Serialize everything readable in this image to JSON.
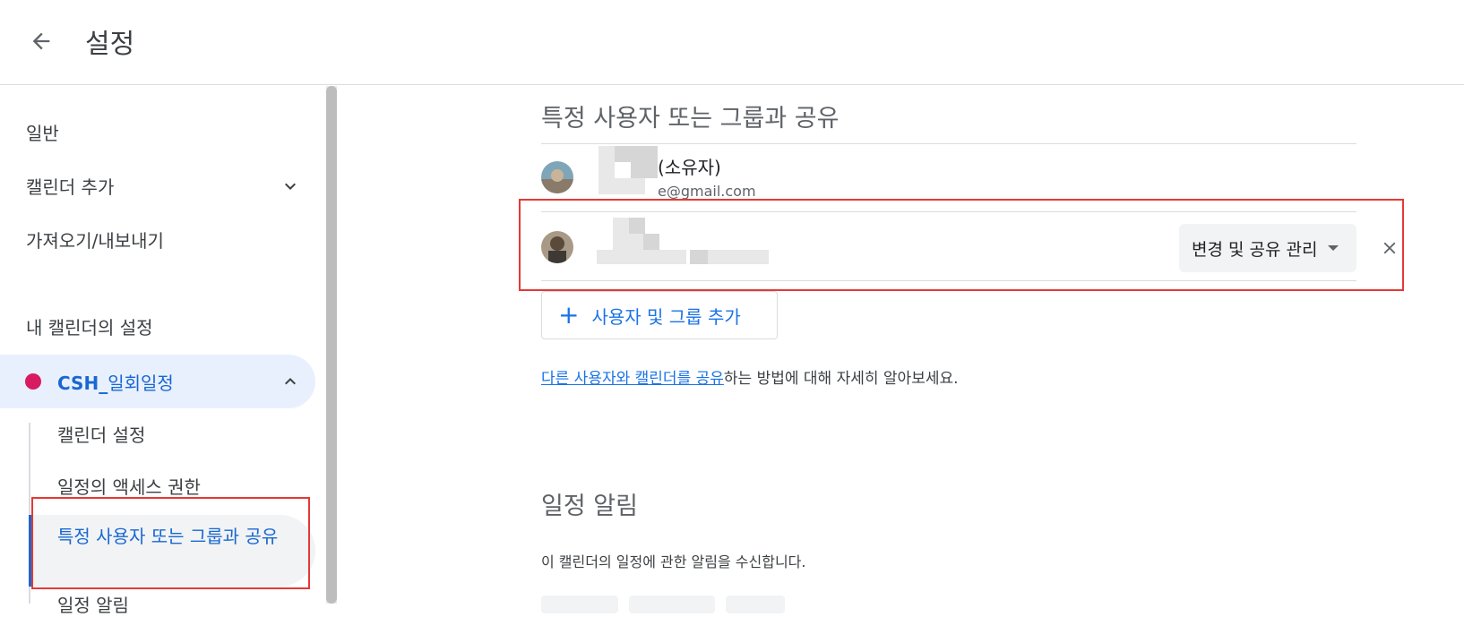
{
  "header": {
    "title": "설정"
  },
  "sidebar": {
    "items": [
      {
        "label": "일반"
      },
      {
        "label": "캘린더 추가"
      },
      {
        "label": "가져오기/내보내기"
      }
    ],
    "section_label": "내 캘린더의 설정",
    "calendar": {
      "name_bold": "CSH_",
      "name_rest": "일회일정",
      "color": "#d81b60"
    },
    "sub_items": [
      {
        "label": "캘린더 설정"
      },
      {
        "label": "일정의 액세스 권한"
      },
      {
        "label": "특정 사용자 또는 그룹과 공유"
      },
      {
        "label": "일정 알림"
      }
    ]
  },
  "sharing": {
    "title": "특정 사용자 또는 그룹과 공유",
    "owner": {
      "name_suffix": "(소유자)",
      "email_suffix": "e@gmail.com"
    },
    "shared_user": {
      "permission": "변경 및 공유 관리"
    },
    "add_button": "사용자 및 그룹 추가",
    "help_link": "다른 사용자와 캘린더를 공유",
    "help_rest": "하는 방법에 대해 자세히 알아보세요."
  },
  "notifications": {
    "title": "일정 알림",
    "description": "이 캘린더의 일정에 관한 알림을 수신합니다."
  },
  "colors": {
    "accent": "#1a73e8",
    "active_bg": "#e8f0fe",
    "highlight": "#e53935"
  }
}
